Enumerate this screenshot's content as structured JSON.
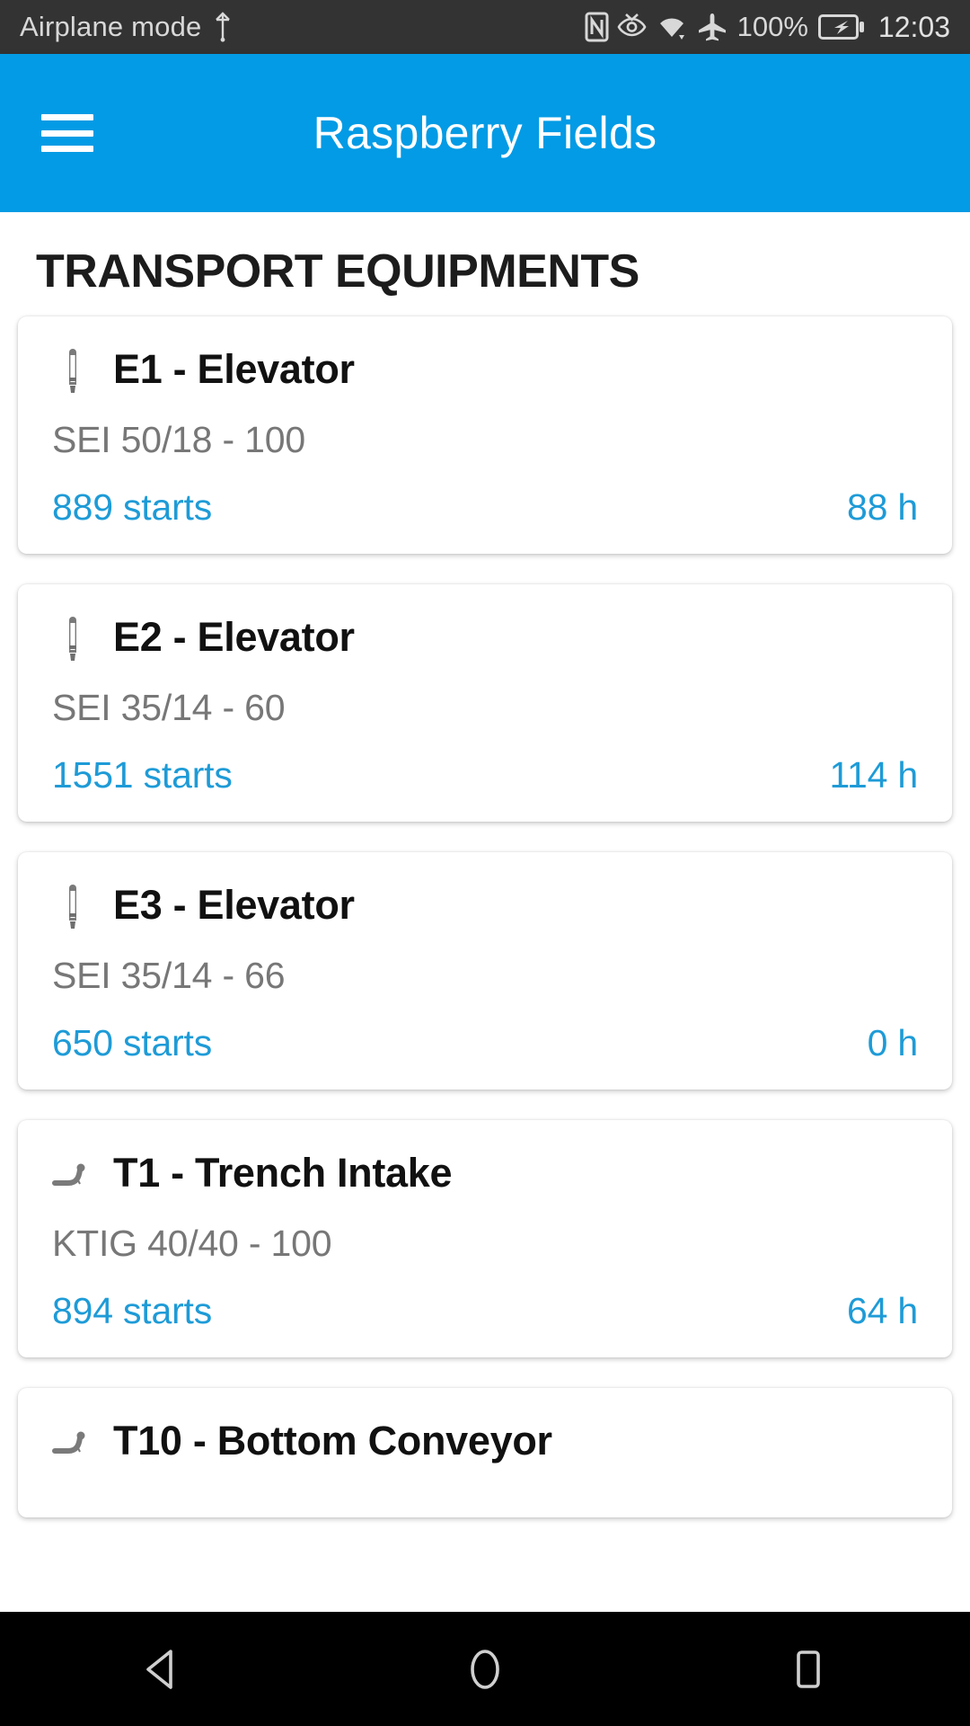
{
  "status_bar": {
    "left_text": "Airplane mode",
    "usb_icon": "usb-icon",
    "icons": [
      "nfc-icon",
      "eye-comfort-icon",
      "wifi-icon",
      "airplane-mode-icon"
    ],
    "battery_percent": "100%",
    "battery_icon": "battery-charging-icon",
    "time": "12:03"
  },
  "app_bar": {
    "menu_icon": "hamburger-menu-icon",
    "title": "Raspberry Fields",
    "background_color": "#039BE5"
  },
  "main": {
    "section_title": "TRANSPORT EQUIPMENTS",
    "accent_color": "#1E9BD7",
    "equipments": [
      {
        "icon": "elevator-icon",
        "name": "E1 - Elevator",
        "model": "SEI 50/18 - 100",
        "starts": "889 starts",
        "hours": "88 h"
      },
      {
        "icon": "elevator-icon",
        "name": "E2 - Elevator",
        "model": "SEI 35/14 - 60",
        "starts": "1551 starts",
        "hours": "114 h"
      },
      {
        "icon": "elevator-icon",
        "name": "E3 - Elevator",
        "model": "SEI 35/14 - 66",
        "starts": "650 starts",
        "hours": "0 h"
      },
      {
        "icon": "conveyor-icon",
        "name": "T1 - Trench Intake",
        "model": "KTIG 40/40 - 100",
        "starts": "894 starts",
        "hours": "64 h"
      },
      {
        "icon": "conveyor-icon",
        "name": "T10 - Bottom Conveyor",
        "model": "",
        "starts": "",
        "hours": ""
      }
    ]
  },
  "nav_bar": {
    "back_icon": "back-triangle-icon",
    "home_icon": "home-circle-icon",
    "recents_icon": "recents-square-icon"
  }
}
